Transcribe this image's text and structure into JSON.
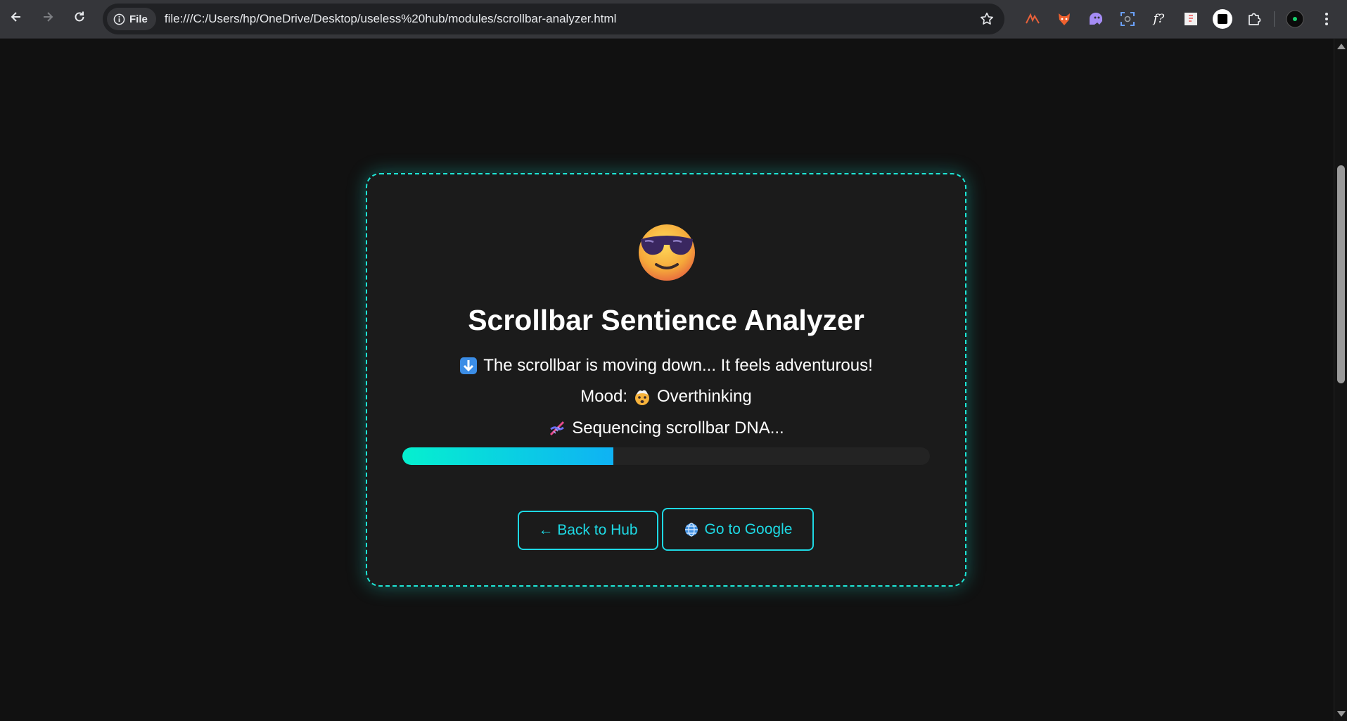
{
  "browser": {
    "nav": {
      "back_icon": "arrow-left-icon",
      "forward_icon": "arrow-right-icon",
      "reload_icon": "reload-icon"
    },
    "site_chip_label": "File",
    "url": "file:///C:/Users/hp/OneDrive/Desktop/useless%20hub/modules/scrollbar-analyzer.html",
    "extensions": [
      "extension-1-icon",
      "fox-extension-icon",
      "ghost-extension-icon",
      "screenshot-extension-icon",
      "formula-extension-icon",
      "document-extension-icon",
      "square-extension-icon",
      "puzzle-icon"
    ],
    "extension_labels": {
      "formula": "f?"
    }
  },
  "card": {
    "emoji": "cool-face-sunglasses",
    "title": "Scrollbar Sentience Analyzer",
    "status_text": "The scrollbar is moving down... It feels adventurous!",
    "mood_label": "Mood:",
    "mood_value": "Overthinking",
    "dna_text": "Sequencing scrollbar DNA...",
    "progress_fraction": 0.4,
    "buttons": {
      "back_label": "← Back to Hub",
      "google_label": "Go to Google"
    }
  },
  "colors": {
    "accent": "#1ee6d6",
    "background": "#111111",
    "card": "#1b1b1b",
    "progress_start": "#05f0cf",
    "progress_end": "#0fb2f4"
  }
}
